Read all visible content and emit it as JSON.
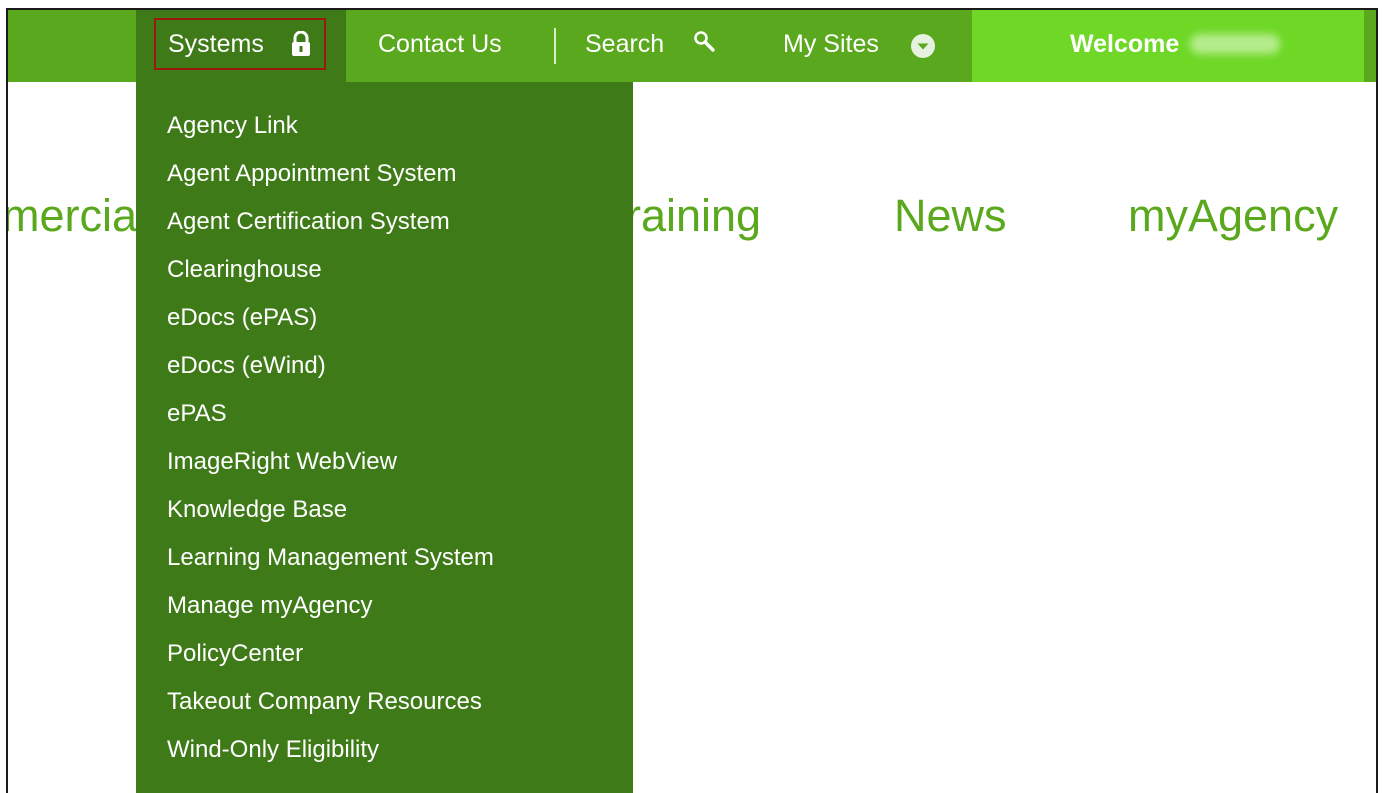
{
  "nav": {
    "systems_label": "Systems",
    "contact_label": "Contact Us",
    "search_label": "Search",
    "mysites_label": "My Sites",
    "welcome_label": "Welcome"
  },
  "background_nav": {
    "commercial_fragment": "mercia",
    "training_fragment": "raining",
    "news": "News",
    "myagency": "myAgency"
  },
  "dropdown": {
    "items": [
      "Agency Link",
      "Agent Appointment System",
      "Agent Certification System",
      "Clearinghouse",
      "eDocs (ePAS)",
      "eDocs (eWind)",
      "ePAS",
      "ImageRight WebView",
      "Knowledge Base",
      "Learning Management System",
      "Manage myAgency",
      "PolicyCenter",
      "Takeout Company Resources",
      "Wind-Only Eligibility"
    ]
  },
  "icons": {
    "lock": "lock-icon",
    "search": "search-icon",
    "mysites": "chevron-down-icon"
  },
  "colors": {
    "topbar": "#5aa81d",
    "dropdown": "#3f7a18",
    "welcome": "#6fd826",
    "highlight_border": "#9a1a10"
  }
}
